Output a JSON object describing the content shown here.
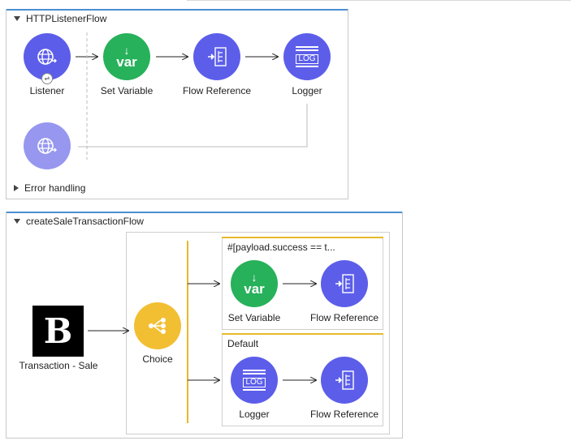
{
  "flow1": {
    "title": "HTTPListenerFlow",
    "error_handling": "Error handling",
    "nodes": {
      "listener": "Listener",
      "set_variable": "Set Variable",
      "flow_reference": "Flow Reference",
      "logger": "Logger"
    }
  },
  "flow2": {
    "title": "createSaleTransactionFlow",
    "nodes": {
      "transaction_sale": "Transaction - Sale",
      "choice": "Choice"
    },
    "routes": [
      {
        "title": "#[payload.success == t...",
        "nodes": [
          "Set Variable",
          "Flow Reference"
        ]
      },
      {
        "title": "Default",
        "nodes": [
          "Logger",
          "Flow Reference"
        ]
      }
    ]
  },
  "icons": {
    "var_text": "var",
    "log_text": "LOG",
    "b_letter": "B"
  },
  "colors": {
    "blue": "#5c5eea",
    "green": "#27b15a",
    "yellow": "#f2bf33",
    "flow_header": "#4a8fd1"
  }
}
